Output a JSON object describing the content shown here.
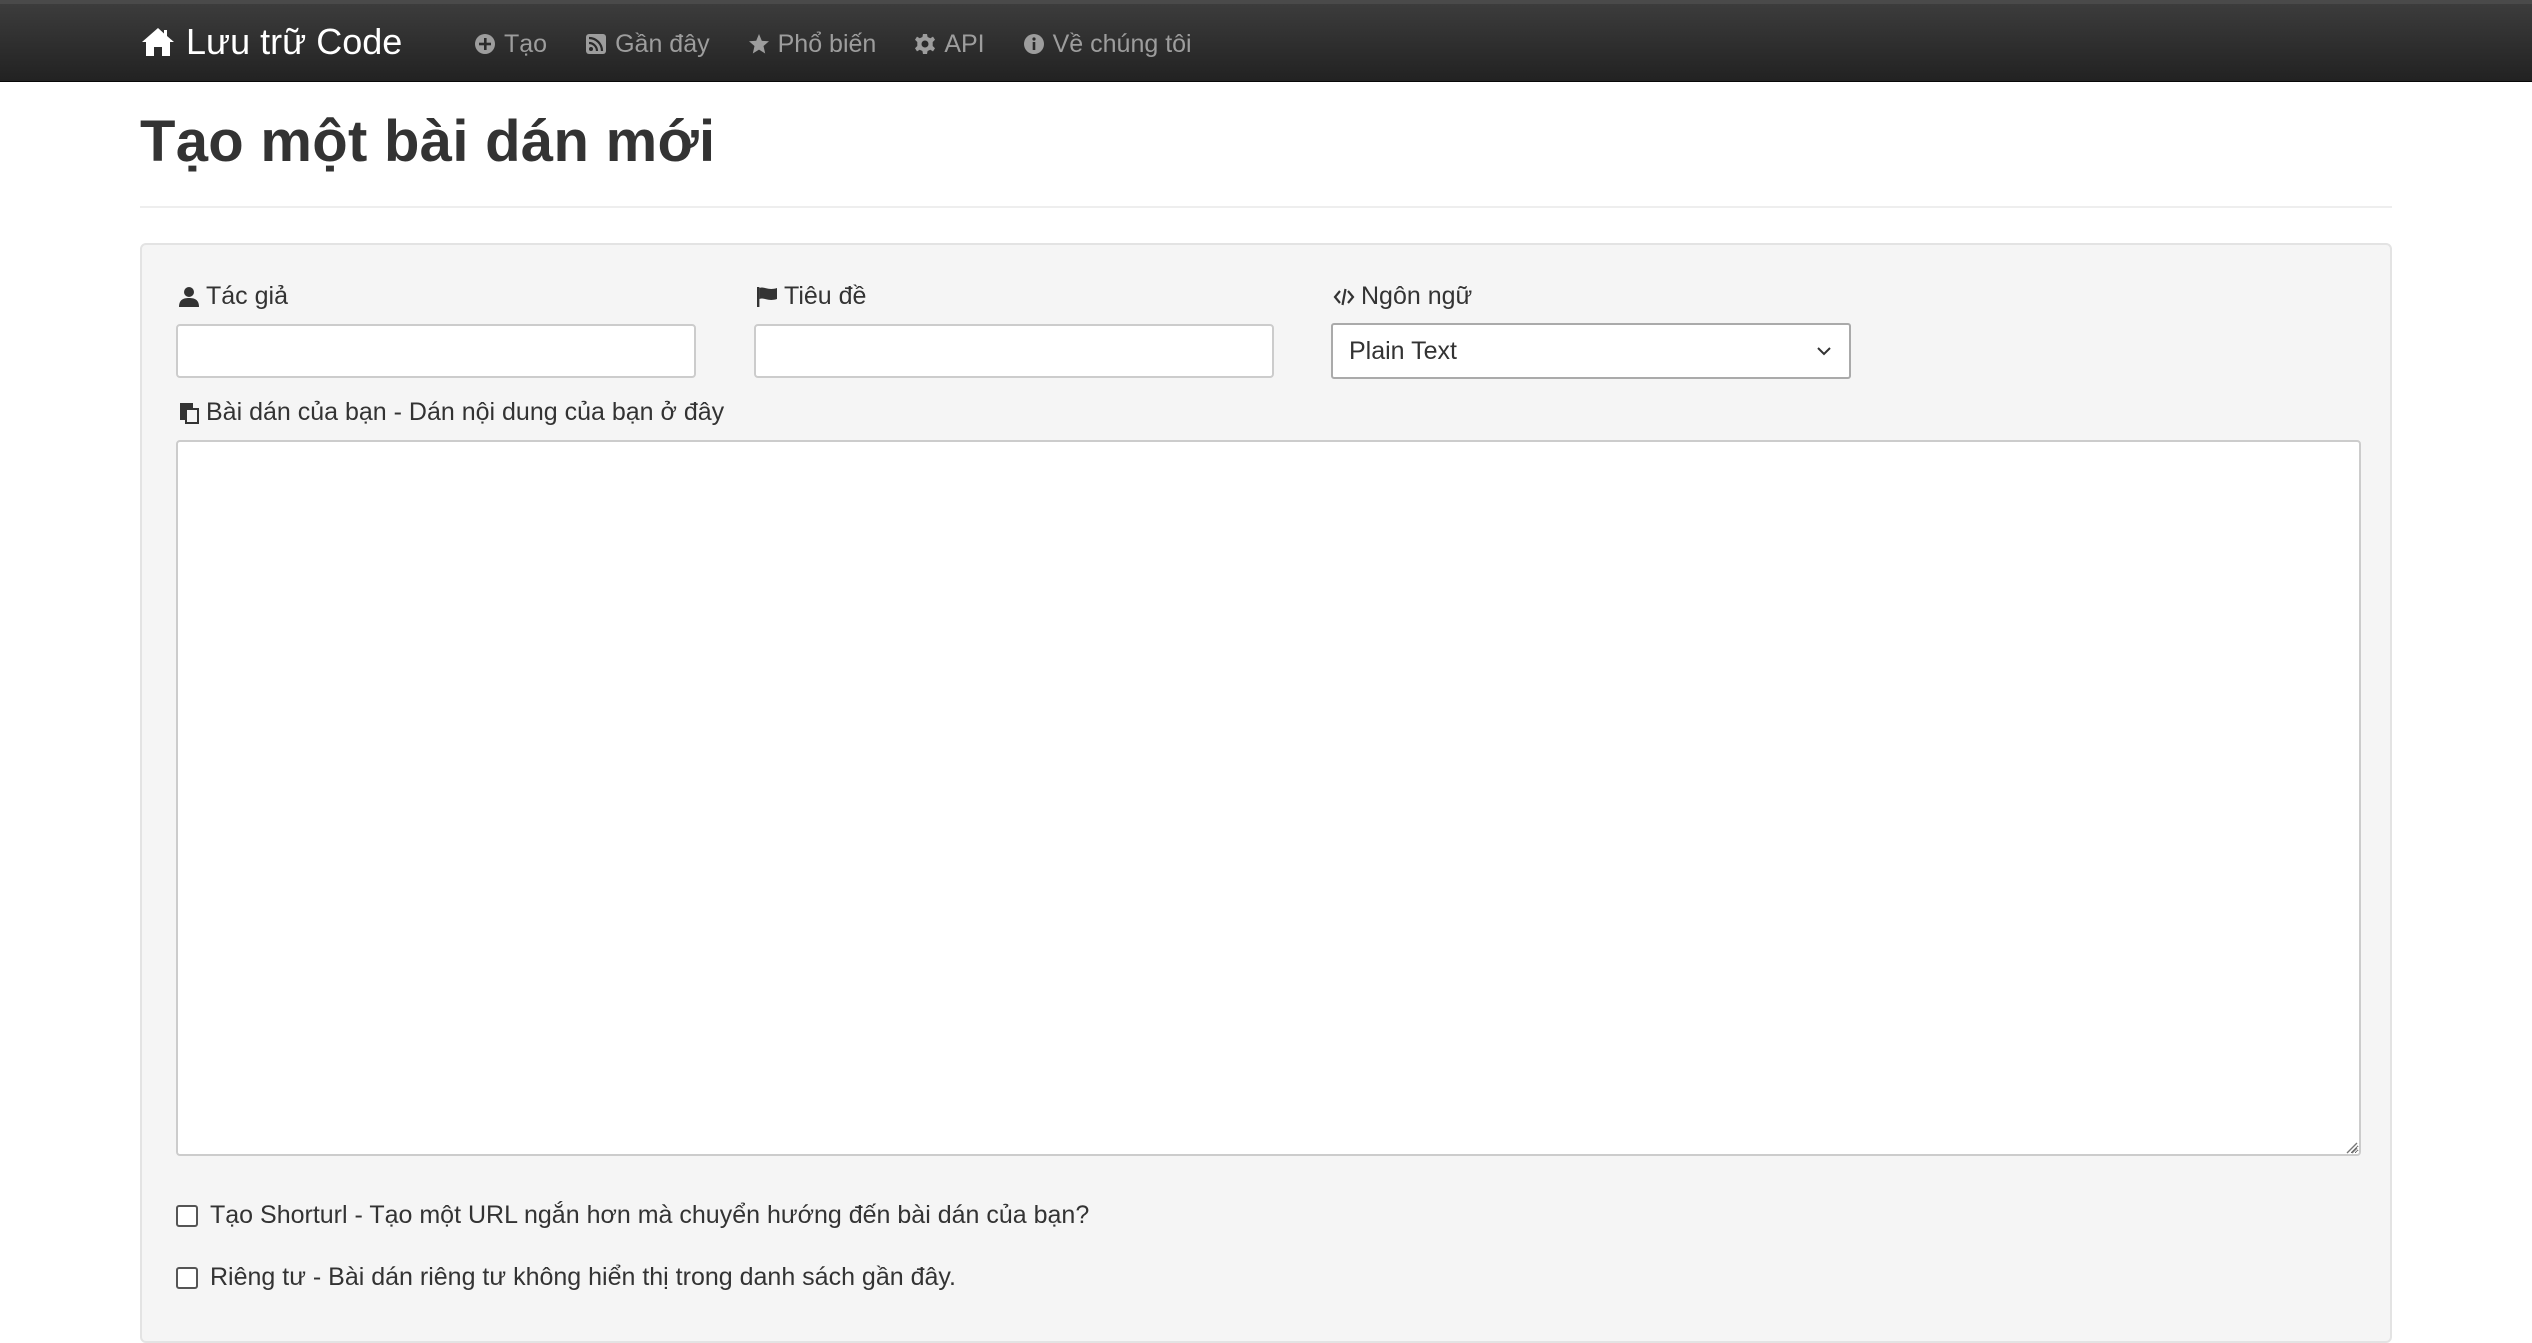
{
  "navbar": {
    "brand": "Lưu trữ Code",
    "items": [
      {
        "label": "Tạo",
        "icon": "plus-circle-icon"
      },
      {
        "label": "Gần đây",
        "icon": "rss-icon"
      },
      {
        "label": "Phổ biến",
        "icon": "star-icon"
      },
      {
        "label": "API",
        "icon": "gear-icon"
      },
      {
        "label": "Về chúng tôi",
        "icon": "info-icon"
      }
    ]
  },
  "page": {
    "title": "Tạo một bài dán mới"
  },
  "form": {
    "author_label": "Tác giả",
    "author_value": "",
    "title_label": "Tiêu đề",
    "title_value": "",
    "language_label": "Ngôn ngữ",
    "language_selected": "Plain Text",
    "paste_label": "Bài dán của bạn - Dán nội dung của bạn ở đây",
    "paste_value": "",
    "shorturl_label": "Tạo Shorturl - Tạo một URL ngắn hơn mà chuyển hướng đến bài dán của bạn?",
    "private_label": "Riêng tư - Bài dán riêng tư không hiển thị trong danh sách gần đây."
  },
  "colors": {
    "navbar": "#222222",
    "nav_text": "#9d9d9d",
    "well": "#f5f5f5"
  }
}
